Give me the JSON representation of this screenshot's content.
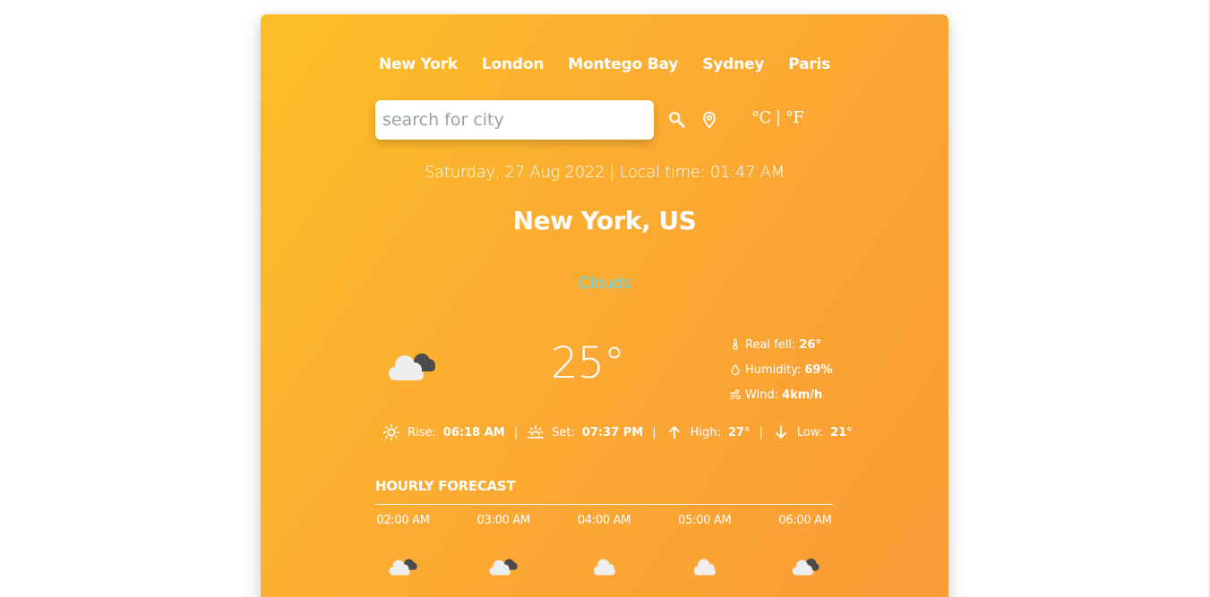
{
  "nav": {
    "cities": [
      "New York",
      "London",
      "Montego Bay",
      "Sydney",
      "Paris"
    ]
  },
  "search": {
    "placeholder": "search for city",
    "value": ""
  },
  "units": {
    "celsius": "°C",
    "separator": "|",
    "fahrenheit": "°F"
  },
  "current": {
    "datetime": "Saturday, 27 Aug 2022 | Local time: 01:47 AM",
    "location": "New York, US",
    "condition": "Clouds",
    "temperature": "25°",
    "icon": "broken-clouds-icon",
    "details": {
      "real_feel_label": "Real fell:",
      "real_feel_value": "26°",
      "humidity_label": "Humidity:",
      "humidity_value": "69%",
      "wind_label": "Wind:",
      "wind_value": "4km/h"
    },
    "sun": {
      "rise_label": "Rise:",
      "rise_value": "06:18 AM",
      "set_label": "Set:",
      "set_value": "07:37 PM",
      "high_label": "High:",
      "high_value": "27°",
      "low_label": "Low:",
      "low_value": "21°",
      "separator": "|"
    }
  },
  "hourly": {
    "title": "HOURLY FORECAST",
    "items": [
      {
        "time": "02:00 AM",
        "icon": "broken-clouds-icon"
      },
      {
        "time": "03:00 AM",
        "icon": "broken-clouds-icon"
      },
      {
        "time": "04:00 AM",
        "icon": "cloud-icon"
      },
      {
        "time": "05:00 AM",
        "icon": "cloud-icon"
      },
      {
        "time": "06:00 AM",
        "icon": "broken-clouds-icon"
      }
    ]
  },
  "colors": {
    "gradient_start": "#fbbf26",
    "gradient_end": "#f99a36",
    "condition_text": "#5fd7f0",
    "cloud_light": "#eeeeee",
    "cloud_dark": "#4b4b4b"
  }
}
